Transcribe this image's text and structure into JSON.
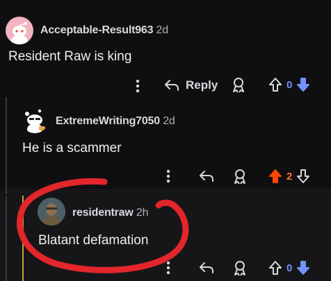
{
  "comments": [
    {
      "username": "Acceptable-Result963",
      "age": "2d",
      "text": "Resident Raw is king",
      "reply_label": "Reply",
      "score": "0",
      "score_color": "#7193ff"
    },
    {
      "username": "ExtremeWriting7050",
      "age": "2d",
      "text": "He is a scammer",
      "score": "2",
      "score_color": "#ff6f3c",
      "upvoted": true
    },
    {
      "username": "residentraw",
      "age": "2h",
      "text": "Blatant defamation",
      "score": "0",
      "score_color": "#7193ff"
    }
  ],
  "icons": [
    "snoo-avatar-icon",
    "more-icon",
    "reply-icon",
    "award-icon",
    "upvote-icon",
    "downvote-icon"
  ],
  "colors": {
    "background": "#0f0f11",
    "highlight": "#161619",
    "annotation_circle": "#e2262a",
    "downvote": "#7193ff",
    "upvote_active": "#ff4500"
  }
}
